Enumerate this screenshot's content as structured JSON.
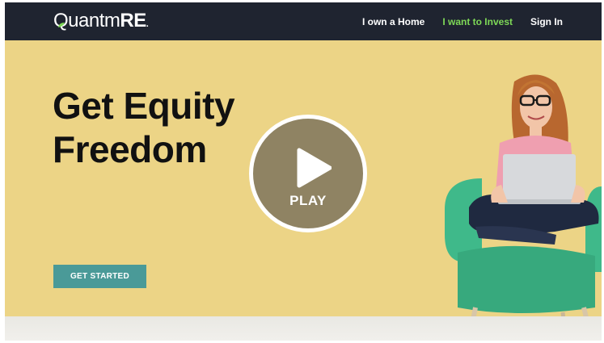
{
  "brand": {
    "name_light": "Quantm",
    "name_bold": "RE",
    "name_suffix": "."
  },
  "nav": {
    "links": [
      {
        "label": "I own a Home"
      },
      {
        "label": "I want to Invest"
      },
      {
        "label": "Sign In"
      }
    ],
    "active_link": "I want to Invest"
  },
  "hero": {
    "headline_line1": "Get Equity",
    "headline_line2": "Freedom",
    "cta_label": "GET STARTED",
    "play_label": "PLAY"
  },
  "colors": {
    "navbar": "#1f2430",
    "hero_background": "#ecd486",
    "accent_green": "#7ed957",
    "cta_teal": "#4a9a98",
    "chair_green": "#3fb98a"
  },
  "icons": [
    "quantm-leaf-icon",
    "play-icon"
  ]
}
